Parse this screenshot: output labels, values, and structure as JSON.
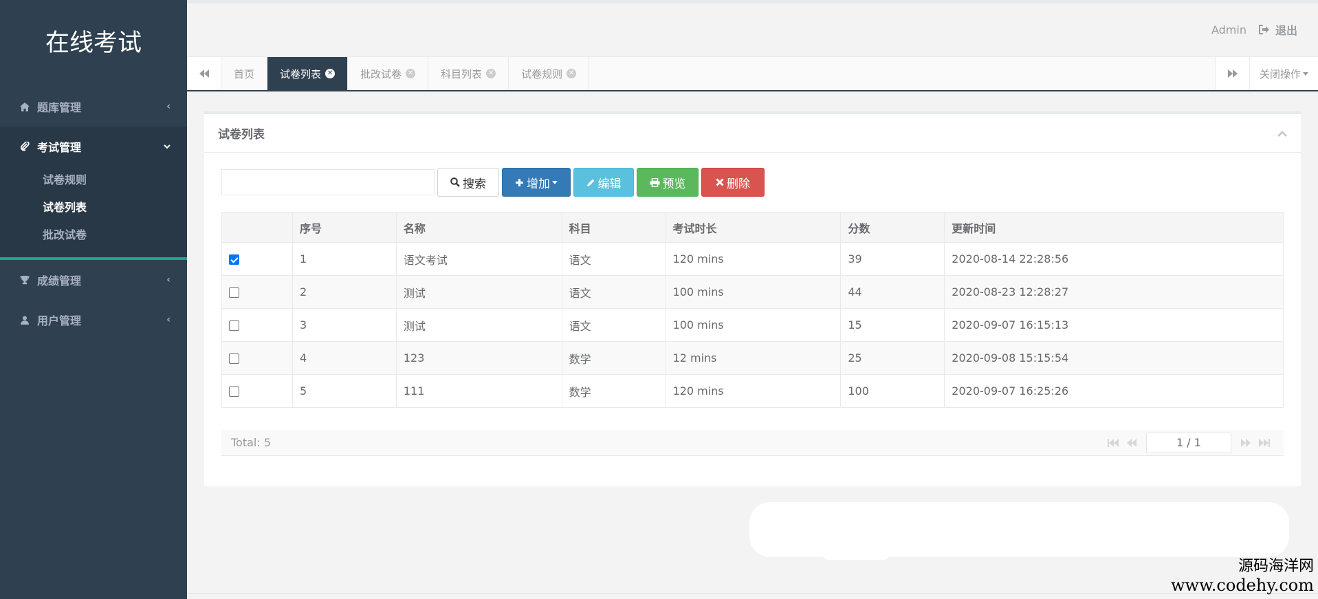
{
  "sidebar": {
    "brand": "在线考试",
    "groups": [
      {
        "label": "题库管理",
        "icon": "home-icon"
      },
      {
        "label": "考试管理",
        "icon": "paperclip-icon",
        "items": [
          "试卷规则",
          "试卷列表",
          "批改试卷"
        ]
      },
      {
        "label": "成绩管理",
        "icon": "trophy-icon"
      },
      {
        "label": "用户管理",
        "icon": "user-icon"
      }
    ]
  },
  "header": {
    "user": "Admin",
    "logout": "退出"
  },
  "tabs": {
    "items": [
      "首页",
      "试卷列表",
      "批改试卷",
      "科目列表",
      "试卷规则"
    ],
    "close_ops": "关闭操作"
  },
  "panel": {
    "title": "试卷列表"
  },
  "toolbar": {
    "search_placeholder": "",
    "search": "搜索",
    "add": "增加",
    "edit": "编辑",
    "preview": "预览",
    "delete": "删除"
  },
  "table": {
    "headers": [
      "序号",
      "名称",
      "科目",
      "考试时长",
      "分数",
      "更新时间"
    ],
    "rows": [
      {
        "checked": true,
        "cells": [
          "1",
          "语文考试",
          "语文",
          "120 mins",
          "39",
          "2020-08-14 22:28:56"
        ]
      },
      {
        "checked": false,
        "cells": [
          "2",
          "测试",
          "语文",
          "100 mins",
          "44",
          "2020-08-23 12:28:27"
        ]
      },
      {
        "checked": false,
        "cells": [
          "3",
          "测试",
          "语文",
          "100 mins",
          "15",
          "2020-09-07 16:15:13"
        ]
      },
      {
        "checked": false,
        "cells": [
          "4",
          "123",
          "数学",
          "12 mins",
          "25",
          "2020-09-08 15:15:54"
        ]
      },
      {
        "checked": false,
        "cells": [
          "5",
          "111",
          "数学",
          "120 mins",
          "100",
          "2020-09-07 16:25:26"
        ]
      }
    ]
  },
  "pager": {
    "total": "Total: 5",
    "page": "1 / 1"
  },
  "watermark": {
    "line1": "源码海洋网",
    "line2": "www.codehy.com"
  },
  "colors": {
    "sidebar": "#2f4050",
    "accent": "#19aa8d",
    "primary": "#337ab7",
    "info": "#5bc0de",
    "success": "#5cb85c",
    "danger": "#d9534f"
  }
}
